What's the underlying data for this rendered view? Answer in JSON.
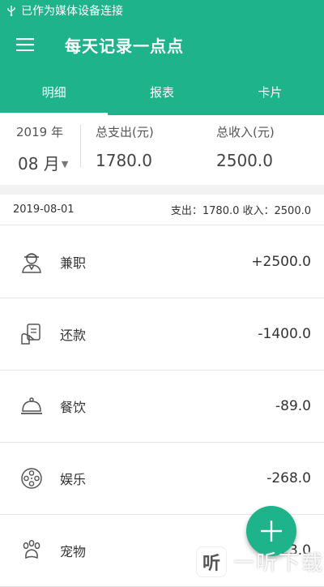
{
  "status_bar": {
    "text": "已作为媒体设备连接"
  },
  "app_bar": {
    "title": "每天记录一点点"
  },
  "tabs": [
    {
      "label": "明细",
      "active": true
    },
    {
      "label": "报表",
      "active": false
    },
    {
      "label": "卡片",
      "active": false
    }
  ],
  "summary": {
    "year": "2019 年",
    "month": "08 月",
    "expense_label": "总支出(元)",
    "expense_value": "1780.0",
    "income_label": "总收入(元)",
    "income_value": "2500.0"
  },
  "day": {
    "date": "2019-08-01",
    "totals": "支出：1780.0 收入：2500.0"
  },
  "records": [
    {
      "category": "兼职",
      "amount": "+2500.0",
      "icon": "worker-icon"
    },
    {
      "category": "还款",
      "amount": "-1400.0",
      "icon": "repayment-icon"
    },
    {
      "category": "餐饮",
      "amount": "-89.0",
      "icon": "food-cloche-icon"
    },
    {
      "category": "娱乐",
      "amount": "-268.0",
      "icon": "film-reel-icon"
    },
    {
      "category": "宠物",
      "amount": "-23.0",
      "icon": "paw-icon"
    }
  ],
  "watermark": {
    "text": "一听下载",
    "logo": "听"
  },
  "colors": {
    "primary": "#1fb38b"
  }
}
